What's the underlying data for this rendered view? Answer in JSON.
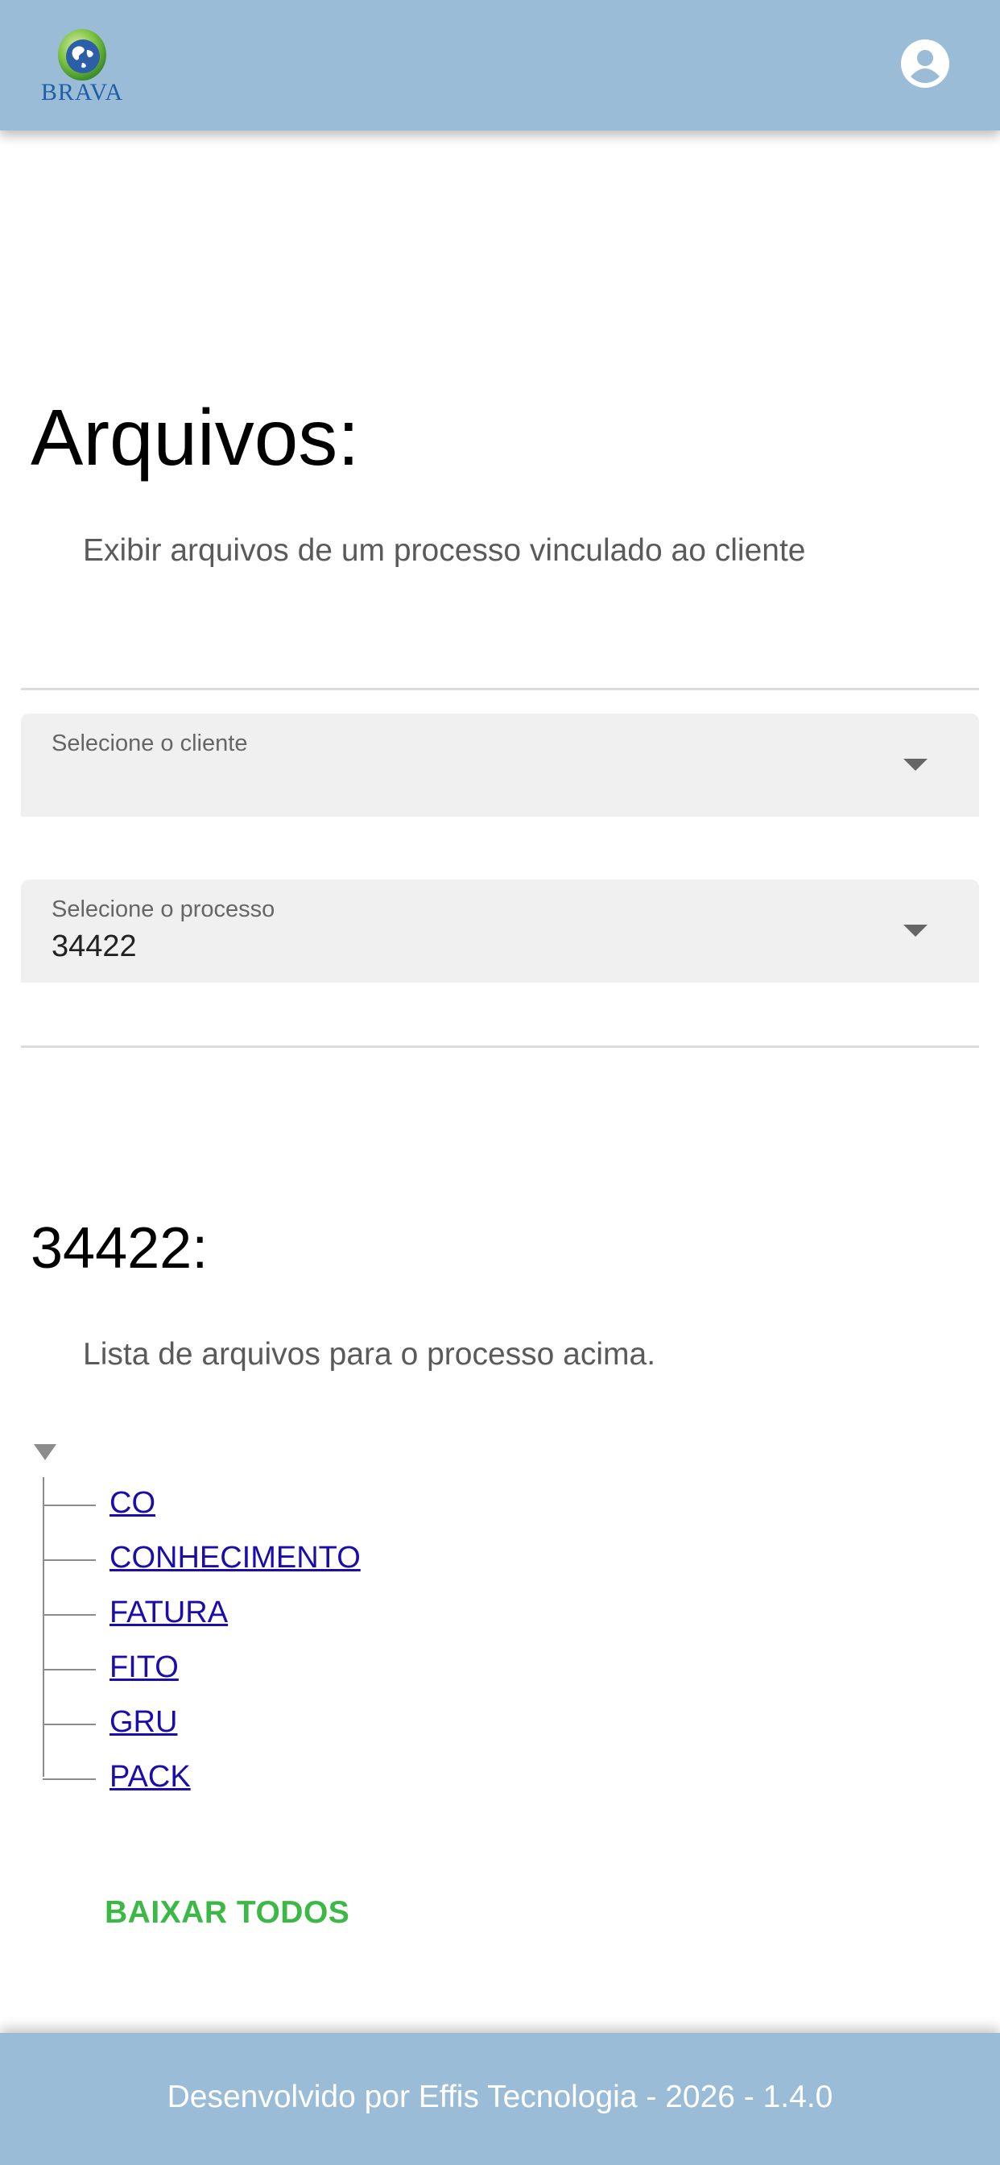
{
  "header": {
    "logo_text": "BRAVA",
    "logo_icon": "globe-icon",
    "account_icon": "account-circle-icon"
  },
  "page": {
    "title": "Arquivos:",
    "subtitle": "Exibir arquivos de um processo vinculado ao cliente"
  },
  "filters": {
    "client": {
      "label": "Selecione o cliente",
      "value": ""
    },
    "process": {
      "label": "Selecione o processo",
      "value": "34422"
    }
  },
  "process_section": {
    "title": "34422:",
    "subtitle": "Lista de arquivos para o processo acima.",
    "folders": [
      "CO",
      "CONHECIMENTO",
      "FATURA",
      "FITO",
      "GRU",
      "PACK"
    ],
    "download_all_label": "BAIXAR TODOS"
  },
  "footer": {
    "text": "Desenvolvido por Effis Tecnologia - 2026 - 1.4.0"
  },
  "colors": {
    "bar": "#9bbcd7",
    "link": "#1a0dab",
    "action": "#3cb846"
  }
}
